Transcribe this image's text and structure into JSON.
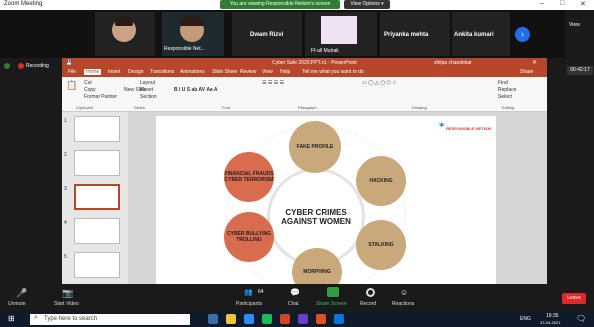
{
  "window": {
    "title": "Zoom Meeting",
    "recording": "Recording"
  },
  "banner": {
    "text": "You are viewing Responsible Netism's screen",
    "view_options": "View Options ▾"
  },
  "participants": [
    {
      "name": ""
    },
    {
      "name": "Responsible Net..."
    },
    {
      "name": "Dwam Rizvi"
    },
    {
      "name": "Ff-all Mutrak"
    },
    {
      "name": "Priyanka mehta"
    },
    {
      "name": "Ankita kumari"
    }
  ],
  "right_bar": {
    "view": "View",
    "time": "00:42:17"
  },
  "ppt": {
    "title": "Cyber Safe 2020.PPT.x1 - PowerPoint",
    "user": "shilpa chandekar",
    "share": "Share",
    "tabs": [
      "File",
      "Home",
      "Insert",
      "Design",
      "Transitions",
      "Animations",
      "Slide Show",
      "Review",
      "View",
      "Help",
      "Tell me what you want to do"
    ],
    "groups": [
      "Clipboard",
      "Slides",
      "Font",
      "Paragraph",
      "Drawing",
      "Editing"
    ],
    "clipboard": [
      "Cut",
      "Copy",
      "Format Painter"
    ],
    "slides_btns": [
      "New Slide",
      "Layout",
      "Reset",
      "Section"
    ],
    "editing": [
      "Find",
      "Replace",
      "Select"
    ],
    "thumb_numbers": [
      "1",
      "2",
      "3",
      "4",
      "5"
    ]
  },
  "slide": {
    "center": "CYBER CRIMES AGAINST WOMEN",
    "bubbles": [
      "FAKE PROFILE",
      "HACKING",
      "STALKING",
      "MORPHING",
      "CYBER BULLYING TROLLING",
      "FINANCIAL FRAUDS CYBER TERRORISM"
    ],
    "logo_text": "RESPONSIBLE NETISM",
    "colors": {
      "tan": "#c9a87c",
      "red": "#d96b4e",
      "logo": "#d63b3b"
    }
  },
  "toolbar": {
    "items": [
      "Unmute",
      "Start Video",
      "Participants",
      "Chat",
      "Share Screen",
      "Record",
      "Reactions"
    ],
    "participant_count": "64",
    "leave": "Leave"
  },
  "taskbar": {
    "search": "Type here to search",
    "lang": "ENG",
    "time": "19:35",
    "date": "22-04-2021"
  }
}
